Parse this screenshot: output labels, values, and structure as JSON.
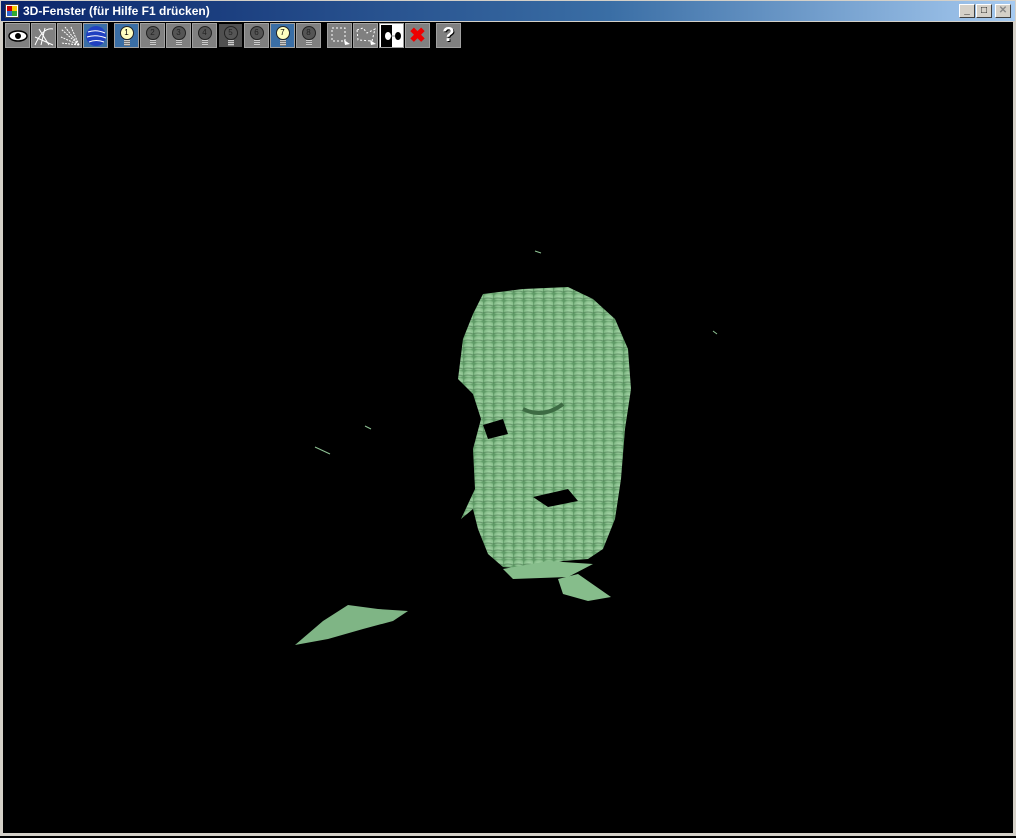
{
  "window": {
    "title": "3D-Fenster (für Hilfe F1 drücken)",
    "minimize": "_",
    "maximize": "□",
    "close": "✕"
  },
  "toolbar": {
    "view_buttons": [
      {
        "icon": "eye-icon"
      },
      {
        "icon": "wireframe-icon"
      },
      {
        "icon": "points-icon"
      },
      {
        "icon": "shaded-sphere-icon"
      }
    ],
    "lights": [
      {
        "label": "1",
        "on": true
      },
      {
        "label": "2",
        "on": false
      },
      {
        "label": "3",
        "on": false
      },
      {
        "label": "4",
        "on": false
      },
      {
        "label": "5",
        "on": false
      },
      {
        "label": "6",
        "on": false
      },
      {
        "label": "7",
        "on": true
      },
      {
        "label": "8",
        "on": false
      }
    ],
    "tools": [
      {
        "icon": "rect-select-icon"
      },
      {
        "icon": "poly-select-icon"
      },
      {
        "icon": "swap-icon"
      },
      {
        "icon": "delete-icon",
        "glyph": "✖"
      }
    ],
    "help": "?"
  },
  "colors": {
    "mesh": "#8fc495",
    "background": "#000000"
  }
}
